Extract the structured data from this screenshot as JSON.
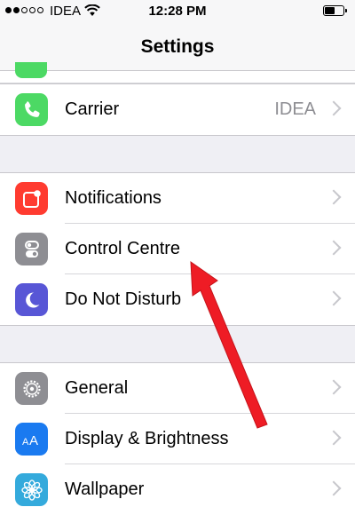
{
  "status_bar": {
    "carrier": "IDEA",
    "time": "12:28 PM",
    "signal_bars_filled": 2,
    "signal_bars_total": 5,
    "battery_level": 0.6
  },
  "nav": {
    "title": "Settings"
  },
  "carrier_row": {
    "label": "Carrier",
    "value": "IDEA",
    "icon": "phone-icon",
    "color": "#4cd964"
  },
  "group_two": [
    {
      "label": "Notifications",
      "icon": "notifications-icon",
      "color": "#ff3b30"
    },
    {
      "label": "Control Centre",
      "icon": "control-centre-icon",
      "color": "#8e8e93"
    },
    {
      "label": "Do Not Disturb",
      "icon": "moon-icon",
      "color": "#5856d6"
    }
  ],
  "group_three": [
    {
      "label": "General",
      "icon": "gear-icon",
      "color": "#8e8e93"
    },
    {
      "label": "Display & Brightness",
      "icon": "display-icon",
      "color": "#1a7af0"
    },
    {
      "label": "Wallpaper",
      "icon": "wallpaper-icon",
      "color": "#34aadc"
    }
  ],
  "annotation": {
    "color": "#ee1c25"
  }
}
